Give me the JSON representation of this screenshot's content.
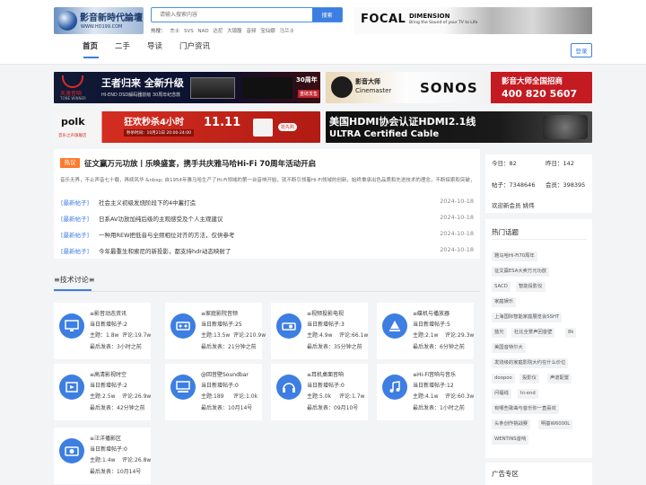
{
  "header": {
    "logo_text": "影音新時代論壇",
    "logo_url": "WWW.HD199.COM",
    "search_placeholder": "请输入搜索内容",
    "search_button": "搜索",
    "hot_label": "热搜：",
    "hot_terms": [
      "杰士",
      "SVS",
      "NAD",
      "达尼",
      "大镜腹",
      "音频",
      "宝仙娜",
      "马兰士"
    ]
  },
  "focal_ad": {
    "brand": "FOCAL",
    "title": "DIMENSION",
    "tagline": "Bring the Sound of your TV to Life"
  },
  "nav": {
    "items": [
      "首页",
      "二手",
      "导读",
      "门户资讯"
    ],
    "login": "登录"
  },
  "banners": {
    "b1": {
      "brand": "天逸音响",
      "brand_en": "TONE WINNER",
      "title": "王者归来 全新升级",
      "sub": "HI-END DSD解码器前级 30周年纪念款",
      "badge": "30周年",
      "badge_sub": "重磅发售"
    },
    "b2": {
      "brand": "影音大师",
      "brand_en": "Cinemaster",
      "sonos": "SONOS",
      "recruit": "影音大师全国招商",
      "phone": "400 820 5607"
    },
    "b3": {
      "brand": "polk",
      "brand_sub": "音乐之声旗舰店",
      "title": "狂欢秒杀4小时",
      "time": "秒杀时间：10月21日 20:00-24:00",
      "date": "11.11",
      "cta": "抢先购"
    },
    "b4": {
      "line1": "美国HDMI协会认证HDMI2.1线",
      "line2": "ULTRA Certified Cable"
    }
  },
  "headline": {
    "tag": "热议",
    "title": "征文赢万元功放丨乐唤盛宴，携手共庆雅马哈Hi-Fi 70周年活动开启",
    "desc": "音乐无界，不止声音七十载，再续风华 &nbsp; 自1954年雅马哈生产了Hi-Fi领域的第一台音响开始，就不断引领着Hi-Fi领域的创新，始终秉承出色品质和先进技术的理念，不断探索和突破，致力于将真实的声音传递给每一位热爱音乐的人。2024年，我们迎来了雅马哈Hi-Fi 70周年，值..."
  },
  "news": [
    {
      "tag": "[最新帖子]",
      "title": "社会主义初级发烧阶段下的4中蓄打造",
      "date": "2024-10-18"
    },
    {
      "tag": "[最新帖子]",
      "title": "日系AV功放加纯后级的主观感受及个人主观建议",
      "date": "2024-10-18"
    },
    {
      "tag": "[最新帖子]",
      "title": "一种用REW把低音与全频相位对齐的方法，仅供参考",
      "date": "2024-10-18"
    },
    {
      "tag": "[最新帖子]",
      "title": "今年最重生和索尼的新投影，都支持hdr动态映射了",
      "date": "2024-10-18"
    }
  ],
  "section": {
    "title": "≡技术讨论≡"
  },
  "forums": [
    {
      "name": "≡影音动态资讯",
      "new": "当日新增帖子:2",
      "topic": "主题：1.8w",
      "reply": "评论:19.7w",
      "last": "最后发表：3小时之前",
      "icon": "monitor-icon"
    },
    {
      "name": "≡家庭影院音频",
      "new": "当日新增帖子:25",
      "topic": "主题:13.5w",
      "reply": "评论:210.9w",
      "last": "最后发表：21分钟之前",
      "icon": "speaker-icon"
    },
    {
      "name": "≡视频投影电视",
      "new": "当日新增帖子:3",
      "topic": "主题:4.9w",
      "reply": "评论:66.1w",
      "last": "最后发表：35分钟之前",
      "icon": "projector-icon"
    },
    {
      "name": "≡碟机与播放器",
      "new": "当日新增帖子:5",
      "topic": "主题:2.1w",
      "reply": "评论:29.3w",
      "last": "最后发表：6分钟之前",
      "icon": "player-icon"
    },
    {
      "name": "≡高清影视时空",
      "new": "当日新增帖子:2",
      "topic": "主题:2.5w",
      "reply": "评论:26.9w",
      "last": "最后发表：42分钟之前",
      "icon": "film-icon"
    },
    {
      "name": "@回音壁Soundbar",
      "new": "当日新增帖子:0",
      "topic": "主题:189",
      "reply": "评论:1.0k",
      "last": "最后发表：10月14号",
      "icon": "soundbar-icon"
    },
    {
      "name": "≡耳机桌面音响",
      "new": "当日新增帖子:0",
      "topic": "主题:5.0k",
      "reply": "评论:1.7w",
      "last": "最后发表：09月10号",
      "icon": "headphone-icon"
    },
    {
      "name": "≡Hi-Fi音响与音乐",
      "new": "当日新增帖子:12",
      "topic": "主题:4.1w",
      "reply": "评论:60.3w",
      "last": "最后发表：1小时之前",
      "icon": "music-icon"
    },
    {
      "name": "≡汪洋播影区",
      "new": "当日新增帖子:0",
      "topic": "主题:1.4w",
      "reply": "评论:26.8w",
      "last": "最后发表：10月14号",
      "icon": "camera-icon"
    }
  ],
  "stats": {
    "today": "今日：82",
    "yesterday": "昨日：142",
    "posts": "帖子：7348646",
    "members": "会员：398395",
    "welcome": "欢迎新会员 姚伟"
  },
  "hot_topics": {
    "title": "热门话题",
    "items": [
      "雅马哈Hi-Fi70周年",
      "征文赢ESA大卖万元功放",
      "SACD",
      "智能投影仪",
      "家庭娱乐",
      "上海国际智能家庭展览会SSHT",
      "蓝光",
      "杜比全景声回音壁",
      "8k",
      "美国音特尔大",
      "发烧级的家庭影院大约在什么价位",
      "doopoo",
      "投影仪",
      "声道配置",
      "问福线",
      "hi-end",
      "有哪些歌曲与音乐你一直喜欢",
      "头条创作挑战赛",
      "明基W6000L",
      "WENTINS音响"
    ]
  },
  "side_ad": {
    "title": "广告专区"
  }
}
